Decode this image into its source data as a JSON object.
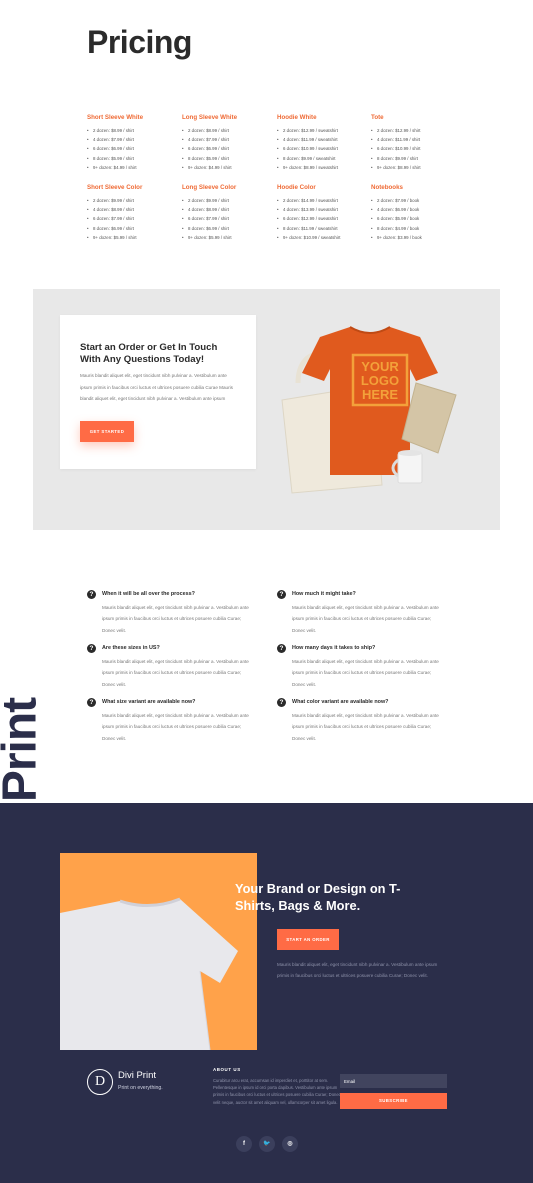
{
  "pricing": {
    "title": "Pricing",
    "rows": [
      [
        {
          "title": "Short Sleeve White",
          "items": [
            "2 dozen: $8.99 / shirt",
            "4 dozen: $7.99 / shirt",
            "6 dozen: $6.99 / shirt",
            "8 dozen: $5.99 / shirt",
            "9+ dozen: $4.99 / shirt"
          ]
        },
        {
          "title": "Long Sleeve White",
          "items": [
            "2 dozen: $8.99 / shirt",
            "4 dozen: $7.99 / shirt",
            "6 dozen: $6.99 / shirt",
            "8 dozen: $5.99 / shirt",
            "9+ dozen: $4.99 / shirt"
          ]
        },
        {
          "title": "Hoodie White",
          "items": [
            "2 dozen: $12.99 / sweatshirt",
            "4 dozen: $11.99 / sweatshirt",
            "6 dozen: $10.99 / sweatshirt",
            "8 dozen: $9.99 / sweatshirt",
            "9+ dozen: $8.99 / sweatshirt"
          ]
        },
        {
          "title": "Tote",
          "items": [
            "2 dozen: $12.99 / shirt",
            "4 dozen: $11.99 / shirt",
            "6 dozen: $10.99 / shirt",
            "8 dozen: $9.99 / shirt",
            "9+ dozen: $8.99 / shirt"
          ]
        }
      ],
      [
        {
          "title": "Short Sleeve Color",
          "items": [
            "2 dozen: $9.99 / shirt",
            "4 dozen: $8.99 / shirt",
            "6 dozen: $7.99 / shirt",
            "8 dozen: $6.99 / shirt",
            "9+ dozen: $5.99 / shirt"
          ]
        },
        {
          "title": "Long Sleeve Color",
          "items": [
            "2 dozen: $9.99 / shirt",
            "4 dozen: $8.99 / shirt",
            "6 dozen: $7.99 / shirt",
            "8 dozen: $6.99 / shirt",
            "9+ dozen: $5.99 / shirt"
          ]
        },
        {
          "title": "Hoodie Color",
          "items": [
            "2 dozen: $14.99 / sweatshirt",
            "4 dozen: $13.99 / sweatshirt",
            "6 dozen: $12.99 / sweatshirt",
            "8 dozen: $11.99 / sweatshirt",
            "9+ dozen: $10.99 / sweatshirt"
          ]
        },
        {
          "title": "Notebooks",
          "items": [
            "2 dozen: $7.99 / book",
            "4 dozen: $6.99 / book",
            "6 dozen: $5.99 / book",
            "8 dozen: $4.99 / book",
            "9+ dozen: $3.99 / book"
          ]
        }
      ]
    ]
  },
  "cta": {
    "title": "Start an Order or Get In Touch With Any Questions Today!",
    "text": "Mauris blandit aliquet elit, eget tincidunt nibh pulvinar a. Vestibulum ante ipsum primis in faucibus orci luctus et ultrices posuere cubilia Curae Mauris blandit aliquet elit, eget tincidunt nibh pulvinar a. Vestibulum ante ipsum",
    "button": "GET STARTED",
    "logo_lines": [
      "YOUR",
      "LOGO",
      "HERE"
    ]
  },
  "faq": [
    {
      "q": "When it will be all over the process?",
      "a": "Mauris blandit aliquet elit, eget tincidunt nibh pulvinar a. Vestibulum ante ipsum primis in faucibus orci luctus et ultrices posuere cubilia Curae; Donec velit."
    },
    {
      "q": "How much it might take?",
      "a": "Mauris blandit aliquet elit, eget tincidunt nibh pulvinar a. Vestibulum ante ipsum primis in faucibus orci luctus et ultrices posuere cubilia Curae; Donec velit."
    },
    {
      "q": "Are these sizes in US?",
      "a": "Mauris blandit aliquet elit, eget tincidunt nibh pulvinar a. Vestibulum ante ipsum primis in faucibus orci luctus et ultrices posuere cubilia Curae; Donec velit."
    },
    {
      "q": "How many days it takes to ship?",
      "a": "Mauris blandit aliquet elit, eget tincidunt nibh pulvinar a. Vestibulum ante ipsum primis in faucibus orci luctus et ultrices posuere cubilia Curae; Donec velit."
    },
    {
      "q": "What size variant are available now?",
      "a": "Mauris blandit aliquet elit, eget tincidunt nibh pulvinar a. Vestibulum ante ipsum primis in faucibus orci luctus et ultrices posuere cubilia Curae; Donec velit."
    },
    {
      "q": "What color variant are available now?",
      "a": "Mauris blandit aliquet elit, eget tincidunt nibh pulvinar a. Vestibulum ante ipsum primis in faucibus orci luctus et ultrices posuere cubilia Curae; Donec velit."
    }
  ],
  "side_word": "Print",
  "brand": {
    "title": "Your Brand or Design on T-Shirts, Bags & More.",
    "button": "START AN ORDER",
    "text": "Mauris blandit aliquet elit, eget tincidunt nibh pulvinar a. Vestibulum ante ipsum primis in faucibus orci luctus et ultrices posuere cubilia Curae; Donec velit."
  },
  "footer": {
    "logo_letter": "D",
    "name": "Divi Print",
    "tagline": "Print on everything.",
    "about_heading": "ABOUT US",
    "about_text": "Curabitur arcu erat, accumsan id imperdiet et, porttitor at sem. Pellentesque in ipsum id orci porta dapibus. Vestibulum ante ipsum primis in faucibus orci luctus et ultrices posuere cubilia Curae; Donec velit neque, auctor sit amet aliquam vel, ullamcorper sit amet ligula. Vivamus suscipit tortor eget felis porttitor volutpat. Vestibulum ac diam sit amet quam vehicula elementum sed sit amet dui.",
    "email_placeholder": "Email",
    "subscribe": "SUBSCRIBE",
    "social": [
      {
        "icon": "facebook-icon",
        "glyph": "f"
      },
      {
        "icon": "twitter-icon",
        "glyph": "🐦"
      },
      {
        "icon": "instagram-icon",
        "glyph": "◎"
      }
    ]
  },
  "colors": {
    "accent": "#ff6b45",
    "dark": "#2b2e4a",
    "orange_panel": "#ffa24a",
    "tshirt": "#e05a1e"
  }
}
